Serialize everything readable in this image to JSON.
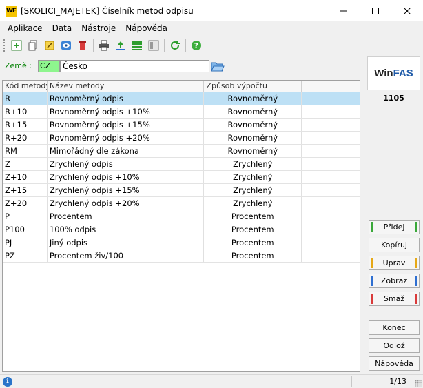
{
  "window": {
    "title": "[SKOLICI_MAJETEK] Číselník metod odpisu",
    "app_logo": "WF"
  },
  "menu": [
    "Aplikace",
    "Data",
    "Nástroje",
    "Nápověda"
  ],
  "toolbar_icons": [
    "add-icon",
    "copy-icon",
    "edit-icon",
    "view-icon",
    "delete-icon",
    "print-icon",
    "export-icon",
    "grid-icon",
    "columns-icon",
    "refresh-icon",
    "help-icon"
  ],
  "filter": {
    "label": "Země :",
    "code": "CZ",
    "name": "Česko"
  },
  "grid": {
    "columns": [
      "Kód metody",
      "Název metody",
      "Způsob výpočtu",
      ""
    ],
    "rows": [
      {
        "code": "R",
        "name": "Rovnoměrný odpis",
        "method": "Rovnoměrný"
      },
      {
        "code": "R+10",
        "name": "Rovnoměrný odpis +10%",
        "method": "Rovnoměrný"
      },
      {
        "code": "R+15",
        "name": "Rovnoměrný odpis +15%",
        "method": "Rovnoměrný"
      },
      {
        "code": "R+20",
        "name": "Rovnoměrný odpis +20%",
        "method": "Rovnoměrný"
      },
      {
        "code": "RM",
        "name": "Mimořádný dle zákona",
        "method": "Rovnoměrný"
      },
      {
        "code": "Z",
        "name": "Zrychlený odpis",
        "method": "Zrychlený"
      },
      {
        "code": "Z+10",
        "name": "Zrychlený odpis +10%",
        "method": "Zrychlený"
      },
      {
        "code": "Z+15",
        "name": "Zrychlený odpis +15%",
        "method": "Zrychlený"
      },
      {
        "code": "Z+20",
        "name": "Zrychlený odpis +20%",
        "method": "Zrychlený"
      },
      {
        "code": "P",
        "name": "Procentem",
        "method": "Procentem"
      },
      {
        "code": "P100",
        "name": "100% odpis",
        "method": "Procentem"
      },
      {
        "code": "PJ",
        "name": "Jiný odpis",
        "method": "Procentem"
      },
      {
        "code": "PZ",
        "name": "Procentem živ/100",
        "method": "Procentem"
      }
    ],
    "selected_index": 0
  },
  "side": {
    "logo_a": "Win",
    "logo_b": "FAS",
    "count": "1105",
    "buttons": {
      "add": "Přidej",
      "copy": "Kopíruj",
      "edit": "Uprav",
      "view": "Zobraz",
      "delete": "Smaž",
      "end": "Konec",
      "postpone": "Odlož",
      "help": "Nápověda"
    },
    "colors": {
      "add": "#3aa83a",
      "edit": "#e6a817",
      "view": "#2f6fd1",
      "delete": "#d93a3a"
    }
  },
  "status": {
    "info_icon": "i",
    "page": "1/13"
  }
}
